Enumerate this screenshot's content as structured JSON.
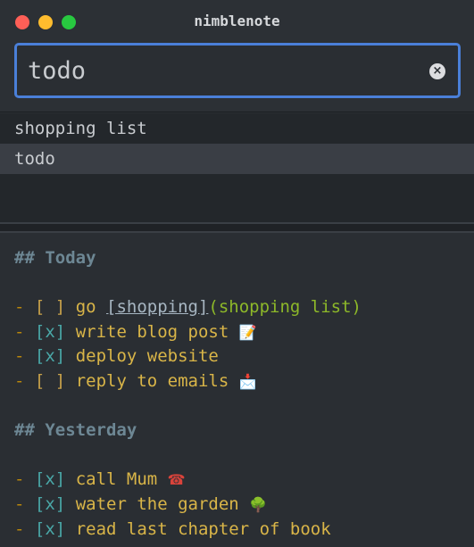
{
  "window": {
    "title": "nimblenote"
  },
  "search": {
    "value": "todo",
    "clear_icon": "×"
  },
  "results": [
    {
      "label": "shopping list",
      "selected": false
    },
    {
      "label": "todo",
      "selected": true
    }
  ],
  "note": {
    "heading_today": "## Today",
    "heading_yesterday": "## Yesterday",
    "dash": "-",
    "box_open": "[ ]",
    "box_done": "[x]",
    "today": {
      "item1_prefix": "go ",
      "item1_link_text": "[shopping]",
      "item1_link_target": "(shopping list)",
      "item2": "write blog post",
      "item2_emoji": "📝",
      "item3": "deploy website",
      "item4": "reply to emails",
      "item4_emoji": "📩"
    },
    "yesterday": {
      "item1": "call Mum",
      "item1_emoji": "☎",
      "item2": "water the garden",
      "item2_emoji": "🌳",
      "item3": "read last chapter of book"
    }
  },
  "colors": {
    "accent": "#4a7fd8",
    "close": "#fe5f57",
    "minimize": "#febc2e",
    "maximize": "#28c840"
  }
}
